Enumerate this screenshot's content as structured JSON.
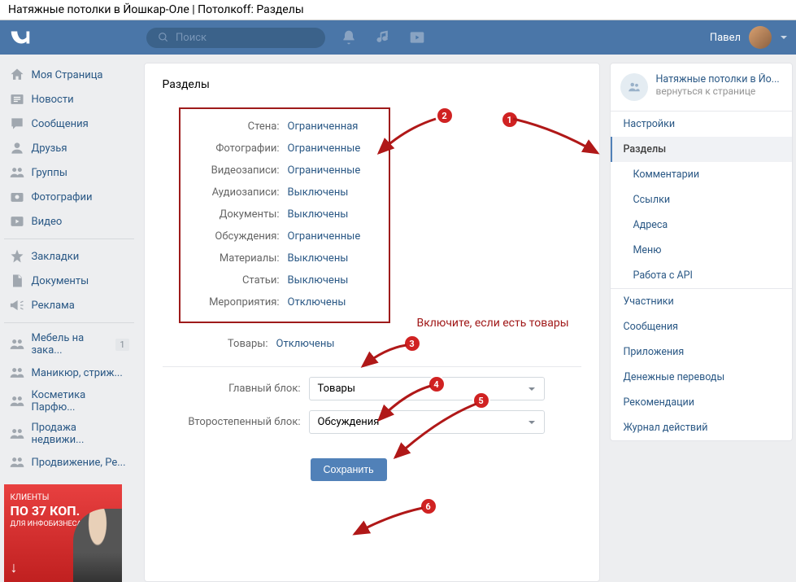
{
  "page_title": "Натяжные потолки в Йошкар-Оле | Потолкоff: Разделы",
  "header": {
    "search_placeholder": "Поиск",
    "username": "Павел"
  },
  "left_nav": {
    "main": [
      {
        "icon": "home",
        "label": "Моя Страница"
      },
      {
        "icon": "news",
        "label": "Новости"
      },
      {
        "icon": "msg",
        "label": "Сообщения"
      },
      {
        "icon": "friends",
        "label": "Друзья"
      },
      {
        "icon": "groups",
        "label": "Группы"
      },
      {
        "icon": "photo",
        "label": "Фотографии"
      },
      {
        "icon": "video",
        "label": "Видео"
      }
    ],
    "secondary": [
      {
        "icon": "star",
        "label": "Закладки"
      },
      {
        "icon": "doc",
        "label": "Документы"
      },
      {
        "icon": "ads",
        "label": "Реклама"
      }
    ],
    "groups": [
      {
        "label": "Мебель на зака...",
        "badge": "1"
      },
      {
        "label": "Маникюр, стриж..."
      },
      {
        "label": "Косметика Парфю..."
      },
      {
        "label": "Продажа недвижи..."
      },
      {
        "label": "Продвижение, Ре..."
      }
    ]
  },
  "ad": {
    "line1": "КЛИЕНТЫ",
    "line2": "ПО 37 КОП.",
    "line3": "ДЛЯ ИНФОБИЗНЕСА"
  },
  "main": {
    "title": "Разделы",
    "settings": [
      {
        "label": "Стена:",
        "value": "Ограниченная"
      },
      {
        "label": "Фотографии:",
        "value": "Ограниченные"
      },
      {
        "label": "Видеозаписи:",
        "value": "Ограниченные"
      },
      {
        "label": "Аудиозаписи:",
        "value": "Выключены"
      },
      {
        "label": "Документы:",
        "value": "Выключены"
      },
      {
        "label": "Обсуждения:",
        "value": "Ограниченные"
      },
      {
        "label": "Материалы:",
        "value": "Выключены"
      },
      {
        "label": "Статьи:",
        "value": "Выключены"
      },
      {
        "label": "Мероприятия:",
        "value": "Отключены"
      }
    ],
    "products_label": "Товары:",
    "products_value": "Отключены",
    "main_block_label": "Главный блок:",
    "main_block_value": "Товары",
    "secondary_block_label": "Второстепенный блок:",
    "secondary_block_value": "Обсуждения",
    "save_label": "Сохранить"
  },
  "right": {
    "group_name": "Натяжные потолки в Йо...",
    "back_text": "вернуться к странице",
    "menu1": [
      {
        "label": "Настройки",
        "sub": false,
        "active": false
      },
      {
        "label": "Разделы",
        "sub": true,
        "active": true
      },
      {
        "label": "Комментарии",
        "sub": true,
        "active": false
      },
      {
        "label": "Ссылки",
        "sub": true,
        "active": false
      },
      {
        "label": "Адреса",
        "sub": true,
        "active": false
      },
      {
        "label": "Меню",
        "sub": true,
        "active": false
      },
      {
        "label": "Работа с API",
        "sub": true,
        "active": false
      }
    ],
    "menu2": [
      {
        "label": "Участники"
      },
      {
        "label": "Сообщения"
      },
      {
        "label": "Приложения"
      },
      {
        "label": "Денежные переводы"
      },
      {
        "label": "Рекомендации"
      },
      {
        "label": "Журнал действий"
      }
    ]
  },
  "annotations": {
    "text": "Включите, если есть товары",
    "n1": "1",
    "n2": "2",
    "n3": "3",
    "n4": "4",
    "n5": "5",
    "n6": "6"
  }
}
